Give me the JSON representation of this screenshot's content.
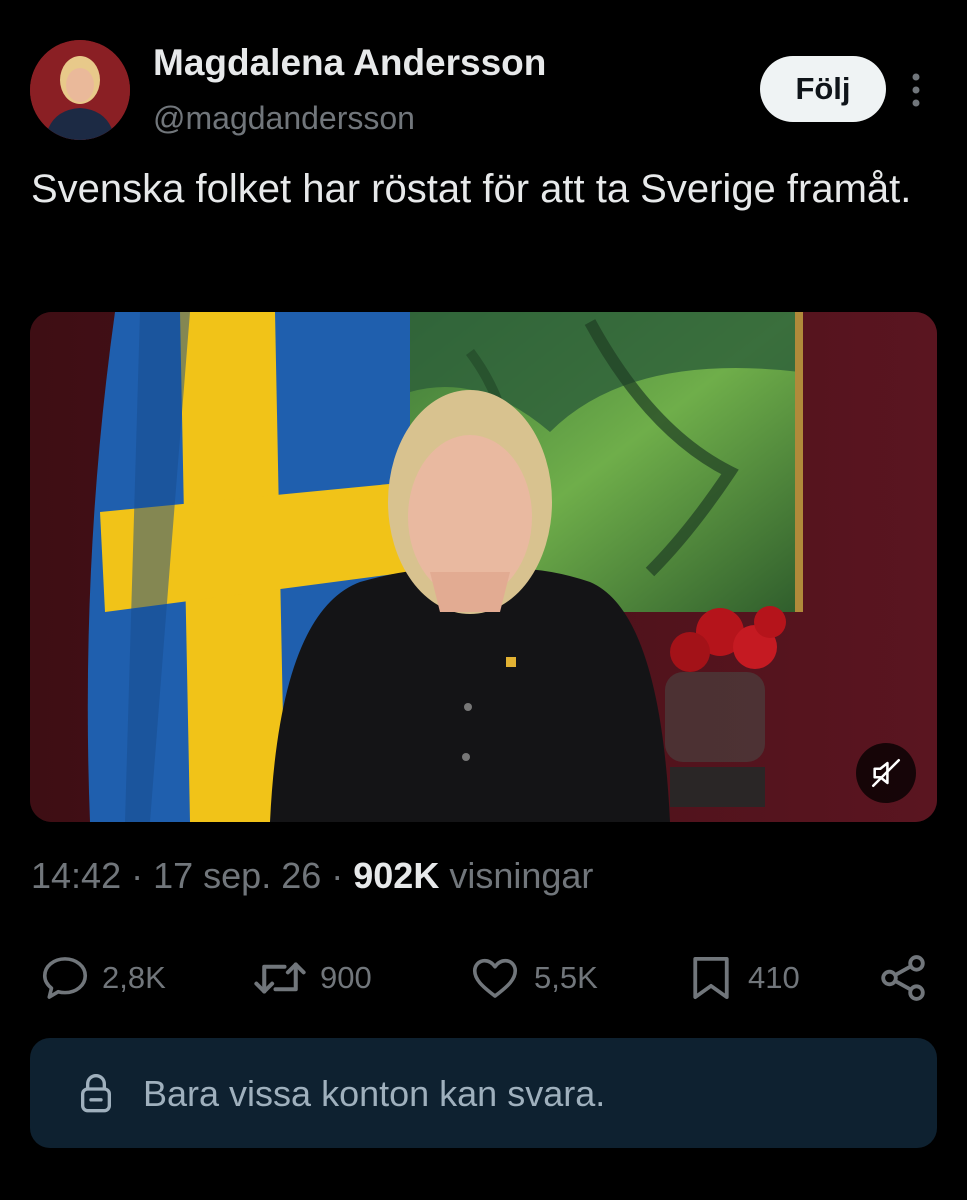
{
  "author": {
    "name": "Magdalena Andersson",
    "handle": "@magdandersson",
    "follow_label": "Följ"
  },
  "tweet": {
    "text": "Svenska folket har röstat för att ta Sverige framåt."
  },
  "meta": {
    "time": "14:42",
    "date": "17 sep. 26",
    "views_count": "902K",
    "views_label": "visningar"
  },
  "actions": {
    "replies": "2,8K",
    "reposts": "900",
    "likes": "5,5K",
    "bookmarks": "410"
  },
  "reply_restriction": {
    "text": "Bara vissa konton kan svara."
  },
  "colors": {
    "background": "#000000",
    "primary_text": "#e7e9ea",
    "secondary_text": "#71767b",
    "follow_button_bg": "#eff3f4",
    "restriction_bg": "#0e2130",
    "flag_blue": "#1f5fae",
    "flag_yellow": "#f1c318"
  },
  "icons": {
    "more": "more-vertical-icon",
    "mute": "muted-speaker-icon",
    "reply": "speech-bubble-icon",
    "repost": "repost-arrows-icon",
    "like": "heart-icon",
    "bookmark": "bookmark-icon",
    "share": "share-icon",
    "lock": "lock-icon"
  }
}
